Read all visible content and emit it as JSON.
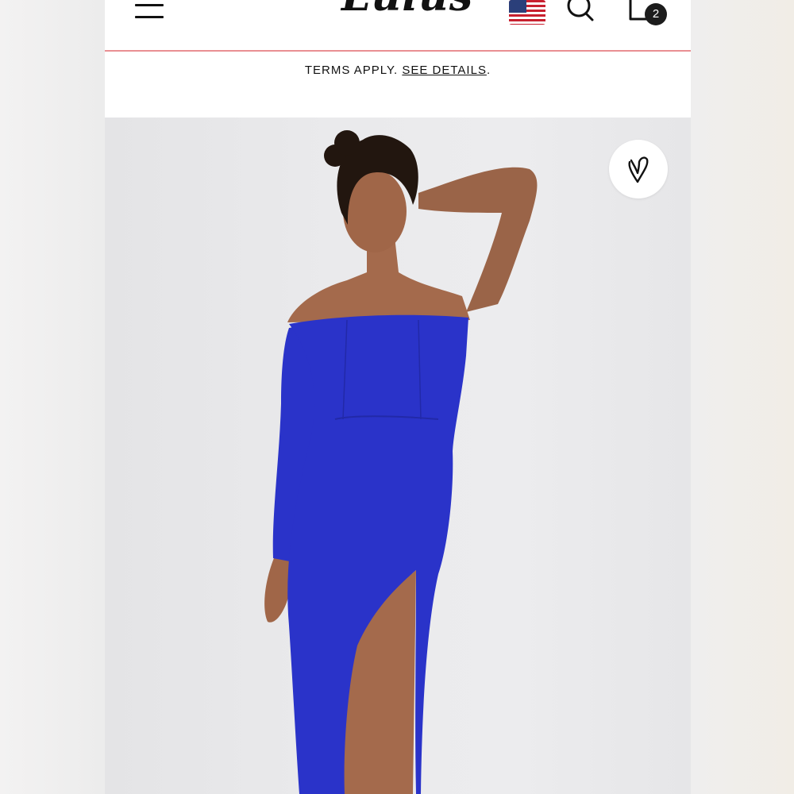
{
  "header": {
    "brand": "Lulus",
    "menu_icon": "hamburger-menu-icon",
    "flag_icon": "us-flag-icon",
    "search_icon": "search-icon",
    "cart_icon": "shopping-bag-icon",
    "cart_count": "2",
    "divider_color": "#e98f93"
  },
  "promo": {
    "prefix": "TERMS APPLY. ",
    "link": "SEE DETAILS",
    "suffix": "."
  },
  "product_image": {
    "wishlist_icon": "heart-icon",
    "dress_color": "#2a33c9"
  }
}
